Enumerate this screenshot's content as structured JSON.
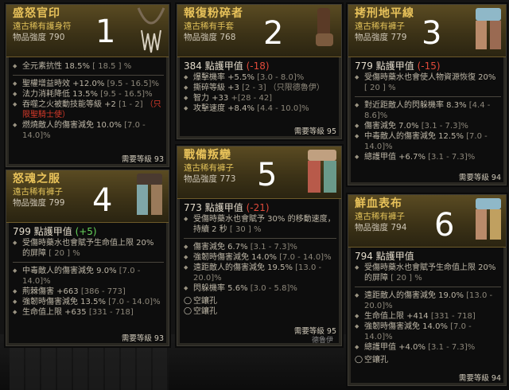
{
  "cards": [
    {
      "name": "盛怒官印",
      "type": "遠古稀有護身符",
      "power": "物品強度 790",
      "number": "1",
      "lines": [
        {
          "text": "全元素抗性 18.5%",
          "range": "[ 18.5 ] %"
        }
      ],
      "affixes": [
        {
          "text": "聖權增益時效 +12.0%",
          "range": "[9.5 - 16.5]%"
        },
        {
          "text": "法力消耗降低 13.5%",
          "range": "[9.5 - 16.5]%"
        },
        {
          "text": "吞噬之火被動技能等級 +2",
          "range": "[1 - 2]",
          "note": "（只限聖騎士使）"
        },
        {
          "text": "燃燒敵人的傷害減免 10.0%",
          "range": "[7.0 - 14.0]%"
        }
      ],
      "required": "需要等級 93"
    },
    {
      "name": "報復粉碎者",
      "type": "遠古稀有手套",
      "power": "物品強度 768",
      "number": "2",
      "armor": "384 點護甲值",
      "armor_delta": "(-18)",
      "affixes": [
        {
          "text": "爆擊機率 +5.5%",
          "range": "[3.0 - 8.0]%"
        },
        {
          "text": "撕碎等級 +3",
          "range": "[2 - 3]",
          "note": "（只限德魯伊）"
        },
        {
          "text": "智力 +33",
          "range": "+[28 - 42]"
        },
        {
          "text": "攻擊速度 +8.4%",
          "range": "[4.4 - 10.0]%"
        }
      ],
      "required": "需要等級 95"
    },
    {
      "name": "拷刑地平線",
      "type": "遠古稀有褲子",
      "power": "物品強度 779",
      "number": "3",
      "armor": "779 點護甲值",
      "armor_delta": "(-15)",
      "implicit": {
        "text": "受傷時藥水也會使人物資源恢復 20%",
        "range": "[ 20 ] %"
      },
      "affixes": [
        {
          "text": "對近距敵人的閃躲機率 8.3%",
          "range": "[4.4 - 8.6]%"
        },
        {
          "text": "傷害減免 7.0%",
          "range": "[3.1 - 7.3]%"
        },
        {
          "text": "中毒敵人的傷害減免 12.5%",
          "range": "[7.0 - 14.0]%"
        },
        {
          "text": "總護甲值 +6.7%",
          "range": "[3.1 - 7.3]%"
        }
      ],
      "required": "需要等級 94"
    },
    {
      "name": "怒魂之服",
      "type": "遠古稀有褲子",
      "power": "物品強度 799",
      "number": "4",
      "armor": "799 點護甲值",
      "armor_delta": "(+5)",
      "implicit": {
        "text": "受傷時藥水也會賦予生命值上限 20% 的屏障",
        "range": "[ 20 ] %"
      },
      "affixes": [
        {
          "text": "中毒敵人的傷害減免 9.0%",
          "range": "[7.0 - 14.0]%"
        },
        {
          "text": "荊棘傷害 +663",
          "range": "[386 - 773]"
        },
        {
          "text": "強韌時傷害減免 13.5%",
          "range": "[7.0 - 14.0]%"
        },
        {
          "text": "生命值上限 +635",
          "range": "[331 - 718]"
        }
      ],
      "required": "需要等級 93"
    },
    {
      "name": "戰備叛變",
      "type": "遠古稀有褲子",
      "power": "物品強度 773",
      "number": "5",
      "armor": "773 點護甲值",
      "armor_delta": "(-21)",
      "implicit": {
        "text": "受傷時藥水也會賦予 30% 的移動速度，持續 2 秒",
        "range": "[ 30 ] %"
      },
      "affixes": [
        {
          "text": "傷害減免 6.7%",
          "range": "[3.1 - 7.3]%"
        },
        {
          "text": "強韌時傷害減免 14.0%",
          "range": "[7.0 - 14.0]%"
        },
        {
          "text": "遠距敵人的傷害減免 19.5%",
          "range": "[13.0 - 20.0]%"
        },
        {
          "text": "閃躲機率 5.6%",
          "range": "[3.0 - 5.8]%"
        }
      ],
      "sockets": [
        "空鑲孔",
        "空鑲孔"
      ],
      "required": "需要等級 95",
      "class_note": "德魯伊"
    },
    {
      "name": "鮮血表布",
      "type": "遠古稀有褲子",
      "power": "物品強度 794",
      "number": "6",
      "armor": "794 點護甲值",
      "implicit": {
        "text": "受傷時藥水也會賦予生命值上限 20% 的屏障",
        "range": "[ 20 ] %"
      },
      "affixes": [
        {
          "text": "遠距敵人的傷害減免 19.0%",
          "range": "[13.0 - 20.0]%"
        },
        {
          "text": "生命值上限 +414",
          "range": "[331 - 718]"
        },
        {
          "text": "強韌時傷害減免 14.0%",
          "range": "[7.0 - 14.0]%"
        },
        {
          "text": "總護甲值 +4.0%",
          "range": "[3.1 - 7.3]%"
        }
      ],
      "sockets": [
        "空鑲孔"
      ],
      "required": "需要等級 94"
    }
  ],
  "colors": {
    "title": "#e8c25a",
    "negative": "#e04a3a",
    "positive": "#66d35a"
  }
}
